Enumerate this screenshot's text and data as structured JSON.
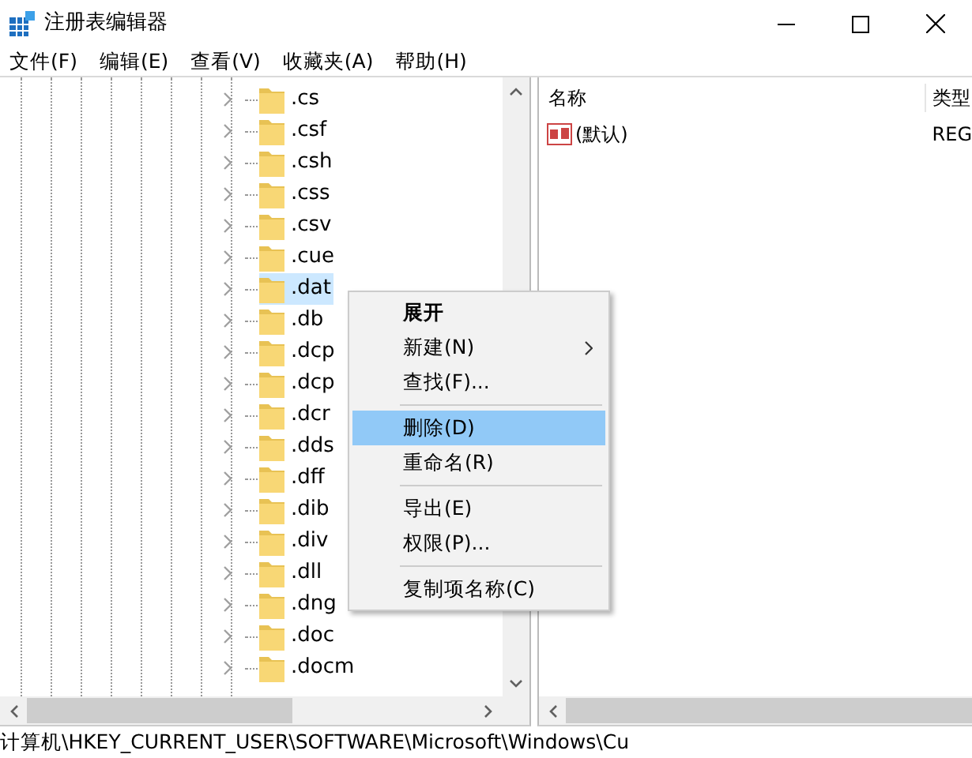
{
  "window": {
    "title": "注册表编辑器"
  },
  "menu": [
    "文件(F)",
    "编辑(E)",
    "查看(V)",
    "收藏夹(A)",
    "帮助(H)"
  ],
  "tree": {
    "items": [
      {
        "label": ".cs",
        "selected": false
      },
      {
        "label": ".csf",
        "selected": false
      },
      {
        "label": ".csh",
        "selected": false
      },
      {
        "label": ".css",
        "selected": false
      },
      {
        "label": ".csv",
        "selected": false
      },
      {
        "label": ".cue",
        "selected": false
      },
      {
        "label": ".dat",
        "selected": true
      },
      {
        "label": ".db",
        "selected": false
      },
      {
        "label": ".dcp",
        "selected": false
      },
      {
        "label": ".dcp",
        "selected": false
      },
      {
        "label": ".dcr",
        "selected": false
      },
      {
        "label": ".dds",
        "selected": false
      },
      {
        "label": ".dff",
        "selected": false
      },
      {
        "label": ".dib",
        "selected": false
      },
      {
        "label": ".div",
        "selected": false
      },
      {
        "label": ".dll",
        "selected": false
      },
      {
        "label": ".dng",
        "selected": false
      },
      {
        "label": ".doc",
        "selected": false
      },
      {
        "label": ".docm",
        "selected": false
      }
    ]
  },
  "values": {
    "columns": [
      "名称",
      "类型"
    ],
    "rows": [
      {
        "name": "(默认)",
        "type": "REG"
      }
    ]
  },
  "context_menu": [
    {
      "kind": "item",
      "label": "展开",
      "default": true,
      "submenu": false,
      "selected": false
    },
    {
      "kind": "item",
      "label": "新建(N)",
      "default": false,
      "submenu": true,
      "selected": false
    },
    {
      "kind": "item",
      "label": "查找(F)...",
      "default": false,
      "submenu": false,
      "selected": false
    },
    {
      "kind": "separator"
    },
    {
      "kind": "item",
      "label": "删除(D)",
      "default": false,
      "submenu": false,
      "selected": true
    },
    {
      "kind": "item",
      "label": "重命名(R)",
      "default": false,
      "submenu": false,
      "selected": false
    },
    {
      "kind": "separator"
    },
    {
      "kind": "item",
      "label": "导出(E)",
      "default": false,
      "submenu": false,
      "selected": false
    },
    {
      "kind": "item",
      "label": "权限(P)...",
      "default": false,
      "submenu": false,
      "selected": false
    },
    {
      "kind": "separator"
    },
    {
      "kind": "item",
      "label": "复制项名称(C)",
      "default": false,
      "submenu": false,
      "selected": false
    }
  ],
  "status_bar": "计算机\\HKEY_CURRENT_USER\\SOFTWARE\\Microsoft\\Windows\\Cu"
}
